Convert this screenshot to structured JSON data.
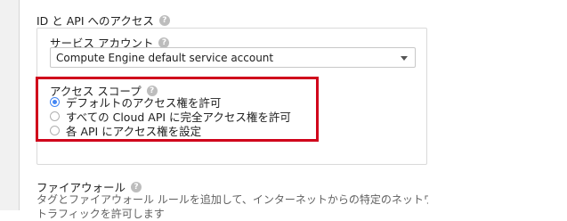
{
  "section": {
    "title": "ID と API へのアクセス"
  },
  "service_account": {
    "label": "サービス アカウント",
    "selected": "Compute Engine default service account"
  },
  "access_scope": {
    "label": "アクセス スコープ",
    "options": [
      {
        "label": "デフォルトのアクセス権を許可",
        "checked": true
      },
      {
        "label": "すべての Cloud API に完全アクセス権を許可",
        "checked": false
      },
      {
        "label": "各 API にアクセス権を設定",
        "checked": false
      }
    ]
  },
  "firewall": {
    "title": "ファイアウォール",
    "description_line1": "タグとファイアウォール ルールを追加して、インターネットからの特定のネットワーク",
    "description_line2": "トラフィックを許可します"
  },
  "icons": {
    "help": "help-icon",
    "dropdown": "dropdown-caret-icon"
  },
  "colors": {
    "highlight": "#d0021b",
    "radio_accent": "#4285f4"
  }
}
